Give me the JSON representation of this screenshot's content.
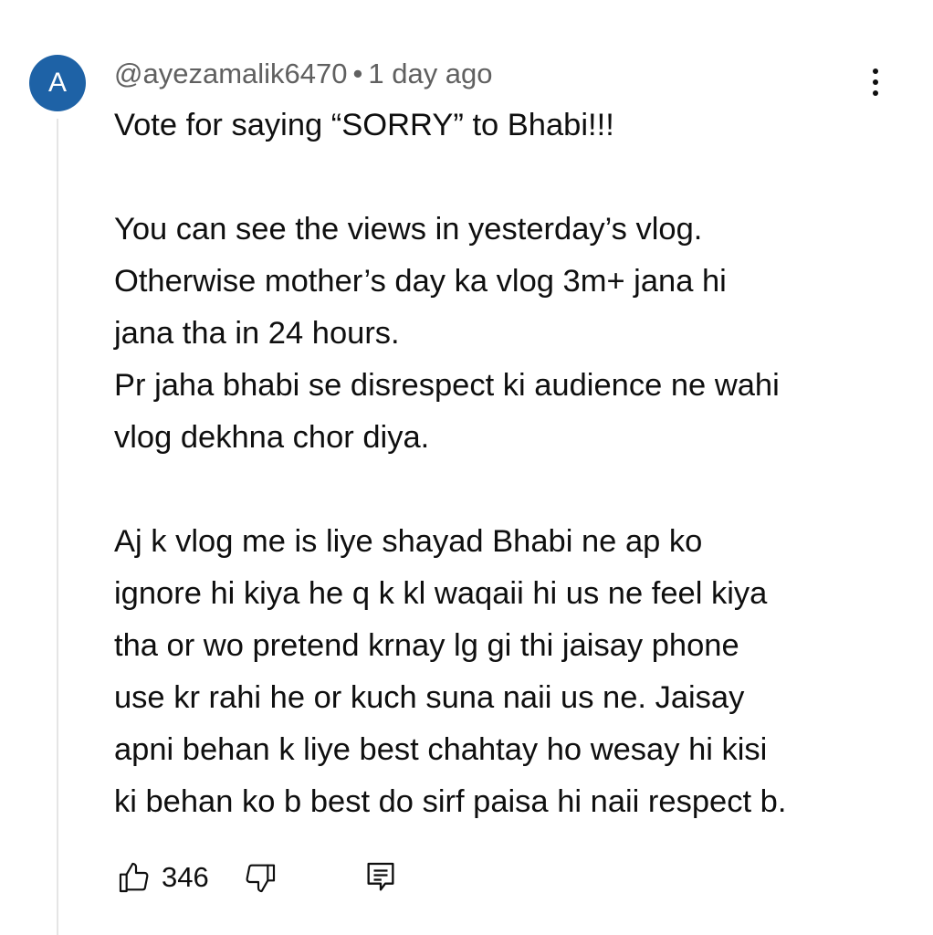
{
  "comment": {
    "avatar_letter": "A",
    "author": "@ayezamalik6470",
    "separator": "•",
    "time": "1 day ago",
    "paragraphs": [
      "Vote for saying “SORRY” to Bhabi!!!",
      "You can see the views in yesterday’s vlog.\nOtherwise mother’s day ka vlog 3m+ jana hi\njana tha in 24 hours.\nPr jaha bhabi se disrespect ki audience ne wahi\nvlog dekhna chor diya.",
      "Aj k vlog me is liye shayad Bhabi ne ap ko\nignore hi kiya he q k kl waqaii hi us ne feel kiya\ntha or wo pretend krnay lg gi thi jaisay phone\nuse kr rahi he or kuch suna naii us ne. Jaisay\napni behan k liye best chahtay ho wesay hi kisi\nki behan ko b best do sirf paisa hi naii respect b."
    ],
    "like_count": "346"
  },
  "icons": {
    "avatar_color": "#1e62a6",
    "menu": "more-vert-icon",
    "like": "thumbs-up-icon",
    "dislike": "thumbs-down-icon",
    "reply": "reply-comment-icon"
  }
}
